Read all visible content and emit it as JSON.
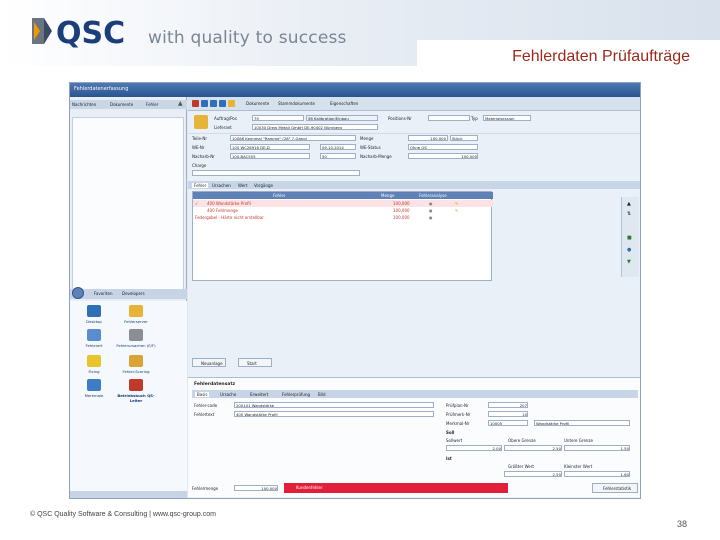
{
  "header": {
    "tagline": "with quality to success",
    "slide_title": "Fehlerdaten Prüfaufträge",
    "logo_text": "QSC"
  },
  "footer": {
    "copyright": "© QSC Quality Software & Consulting | www.qsc-group.com",
    "page_number": "38"
  },
  "app": {
    "window_title": "Fehlerdatenerfassung",
    "left_tabs": [
      "Nachrichten",
      "Dokumente",
      "Fehler"
    ],
    "left_bar_tabs": [
      "Favoriten",
      "Developers"
    ],
    "icons": [
      {
        "label": "Desktop",
        "icon": "desktop-icon"
      },
      {
        "label": "Fehlerserver",
        "icon": "folder-icon"
      },
      {
        "label": "Fehlerart",
        "icon": "error-type-icon"
      },
      {
        "label": "Fehlerursachen (E/F)",
        "icon": "tools-icon"
      },
      {
        "label": "Fixing",
        "icon": "wrench-icon"
      },
      {
        "label": "Fehler-Scoring",
        "icon": "scoring-icon"
      },
      {
        "label": "Merkmale",
        "icon": "features-icon"
      },
      {
        "label": "Betriebsbuch QS-Leiter",
        "icon": "book-icon"
      }
    ],
    "toolbar": [
      "Dokumente",
      "Stammdokumente",
      "Eigenschaften"
    ],
    "form": {
      "auftrag_label": "Auftrag/Pos",
      "auftrag_value": "79",
      "auftrag_desc": "58 Kalibration/Einbau",
      "lieferant_label": "Lieferant",
      "lieferant_value": "10030  Drew Metall GmbH  DE-90402 Nürnberg",
      "positions_label": "Positions-Nr",
      "typ_label": "Typ",
      "typ_value": "Materialsession",
      "teil_label": "Teile-Nr",
      "teil_value": "10086 Kennmal \"Ramme\" (28\" 7-Gang)",
      "menge_label": "Menge",
      "menge_value": "100,000",
      "menge_unit": "Stück",
      "wes_label": "WE-Nr",
      "wes_value": "100 WC26916 DE-D",
      "wes_date": "09.10.2014",
      "wes_status_label": "WE-Status",
      "wes_status_value": "Ohne QS",
      "nacharb_label": "Nacharb-Nr",
      "nacharb_value": "100-BAC555",
      "nacharb_num": "50",
      "nacharb_menge_label": "Nacharb-Menge",
      "nacharb_menge_value": "100,000",
      "charge_label": "Charge"
    },
    "mid_tabs": [
      "Fehler",
      "Ursachen",
      "Wert",
      "Vorgänge"
    ],
    "grid": {
      "headers": [
        "Fehler",
        "Menge",
        "Fehleranalyse"
      ],
      "rows": [
        {
          "text": "400 Wandstärke Profil",
          "menge": "100,000"
        },
        {
          "text": "400 Fehlmenge",
          "menge": "100,000"
        },
        {
          "text": "Federgabel - Härte nicht erstellbar",
          "menge": "100,000"
        }
      ]
    },
    "buttons": {
      "neu": "Neuanlage",
      "hoch": "Start"
    },
    "fehlersatz": {
      "title": "Fehlerdatensatz",
      "tabs": [
        "Basis",
        "Ursache",
        "Erweitert",
        "Fehlerprüfung",
        "Bild"
      ],
      "fehler_code_label": "Fehler-code",
      "fehler_code_value": "200101 Wandstärke",
      "fehlertext_label": "Fehlertext",
      "fehlertext_value": "400 Wandstärke Profil",
      "pruefplan_label": "Prüfplan-Nr",
      "pruefplan_value": "207",
      "pruefmerk_label": "Prüfmerk-Nr",
      "pruefmerk_value": "10",
      "merkmal_label": "Merkmal-Nr",
      "merkmal_value": "10005",
      "merkmal_desc": "Wandstärke Profil",
      "soll_label": "Soll",
      "sollwert_label": "Sollwert",
      "obere_label": "Obere Grenze",
      "untere_label": "Untere Grenze",
      "sollwert": "2,00",
      "obere": "2,50",
      "untere": "1,50",
      "ist_label": "Ist",
      "groesster_label": "Größter Wert",
      "kleinster_label": "Kleinster Wert",
      "groesster": "2,50",
      "kleinster": "1,60",
      "fehlermenge_label": "Fehlermenge",
      "fehlermenge_value": "100,000",
      "status_value": "Kundenfehler",
      "statistik_button": "Fehlerstatistik"
    }
  }
}
